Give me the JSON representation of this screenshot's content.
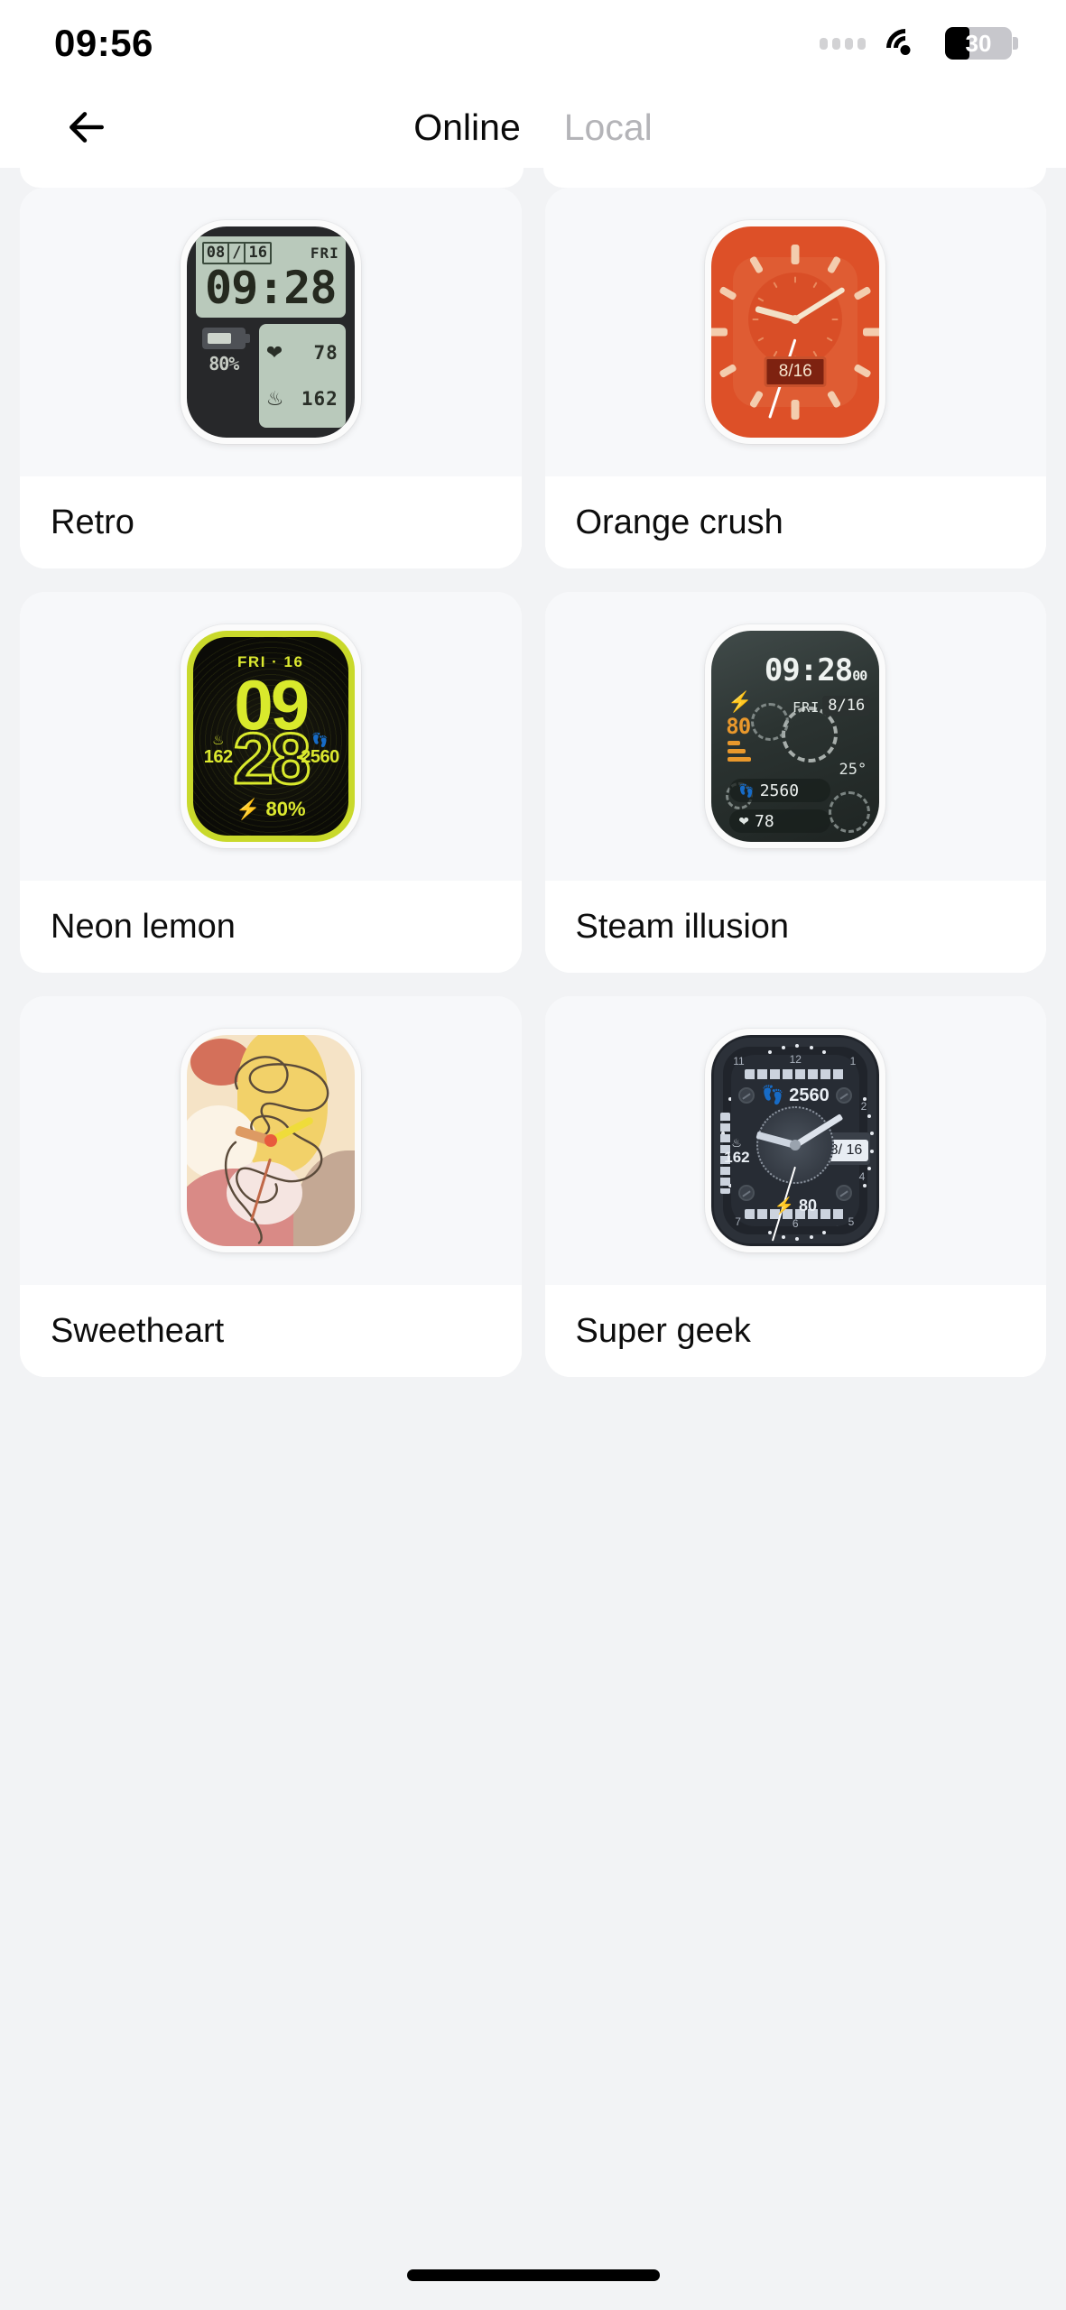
{
  "status_bar": {
    "time": "09:56",
    "battery_level": "30",
    "wifi_icon": "wifi-icon",
    "signal_icon": "signal-dots-icon"
  },
  "nav": {
    "back_icon": "back-arrow-icon",
    "tabs": [
      {
        "label": "Online",
        "active": true
      },
      {
        "label": "Local",
        "active": false
      }
    ]
  },
  "watch_faces": [
    {
      "name": "Retro",
      "style": "retro",
      "display": {
        "date": [
          "08",
          "/",
          "16"
        ],
        "weekday": "FRI",
        "time": "09:28",
        "battery": "80%",
        "heart_icon": "heart-icon",
        "heart_rate": "78",
        "calories_icon": "flame-icon",
        "calories": "162"
      }
    },
    {
      "name": "Orange crush",
      "style": "orange",
      "display": {
        "date": "8/16"
      },
      "colors": {
        "face": "#dd5028",
        "ticks": "#f3cdae"
      }
    },
    {
      "name": "Neon lemon",
      "style": "neon",
      "display": {
        "header": "FRI · 16",
        "hour": "09",
        "minute": "28",
        "calories_icon": "flame-icon",
        "calories": "162",
        "steps_icon": "footsteps-icon",
        "steps": "2560",
        "battery_icon": "bolt-icon",
        "battery": "80%"
      },
      "colors": {
        "accent": "#d9e92c",
        "bezel": "#c9d92b"
      }
    },
    {
      "name": "Steam illusion",
      "style": "steam",
      "display": {
        "time": "09:28",
        "seconds": "00",
        "weekday": "FRI",
        "date": "8/16",
        "battery_icon": "bolt-icon",
        "battery": "80",
        "temperature": "25°",
        "steps_icon": "footsteps-icon",
        "steps": "2560",
        "heart_icon": "heart-icon",
        "heart_rate": "78"
      },
      "colors": {
        "accent": "#e9982c"
      }
    },
    {
      "name": "Sweetheart",
      "style": "sweet",
      "display": {},
      "colors": {
        "cream": "#f5e3c6",
        "yellow": "#f2d169",
        "coral": "#d4705a",
        "pink": "#d98a86",
        "tan": "#c4a894"
      }
    },
    {
      "name": "Super geek",
      "style": "geek",
      "display": {
        "steps_icon": "footsteps-icon",
        "steps": "2560",
        "calories_icon": "flame-icon",
        "calories": "162",
        "date": "08/ 16",
        "battery_icon": "bolt-icon",
        "battery": "80",
        "hour_markers": [
          "11",
          "12",
          "1",
          "2",
          "4",
          "5",
          "6",
          "7"
        ]
      }
    }
  ],
  "home_indicator": "home-indicator"
}
